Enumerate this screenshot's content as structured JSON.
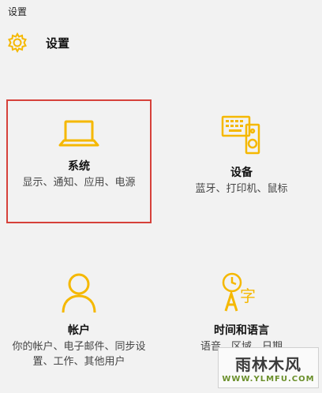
{
  "window": {
    "title": "设置"
  },
  "header": {
    "icon": "gear-icon",
    "title": "设置"
  },
  "tiles": {
    "system": {
      "icon": "laptop-icon",
      "title": "系统",
      "description": "显示、通知、应用、电源"
    },
    "devices": {
      "icon": "devices-icon",
      "title": "设备",
      "description": "蓝牙、打印机、鼠标"
    },
    "accounts": {
      "icon": "person-icon",
      "title": "帐户",
      "description": "你的帐户、电子邮件、同步设置、工作、其他用户"
    },
    "time_language": {
      "icon": "clock-language-icon",
      "title": "时间和语言",
      "description": "语音、区域、日期"
    }
  },
  "watermark": {
    "main": "雨林木风",
    "sub": "WWW.YLMFU.COM"
  },
  "colors": {
    "accent": "#f5b800",
    "selection_border": "#d6413a",
    "background": "#f2f2f2"
  }
}
